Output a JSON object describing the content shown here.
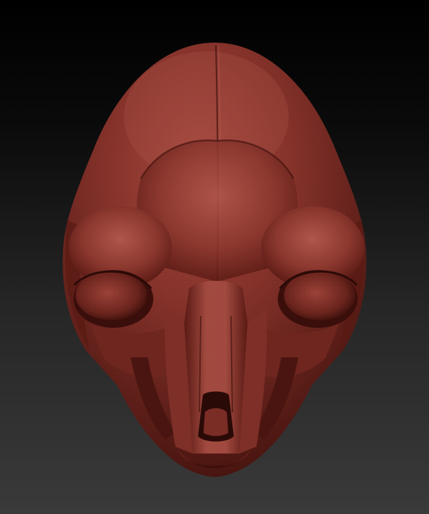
{
  "scene": {
    "subject_icon": "clay-alien-head-sculpt",
    "colors": {
      "background_top": "#000000",
      "background_bottom": "#3a3a3a",
      "clay_base": "#7a2a22",
      "clay_highlight": "#b0564b",
      "clay_shadow": "#3a0e0a"
    }
  }
}
